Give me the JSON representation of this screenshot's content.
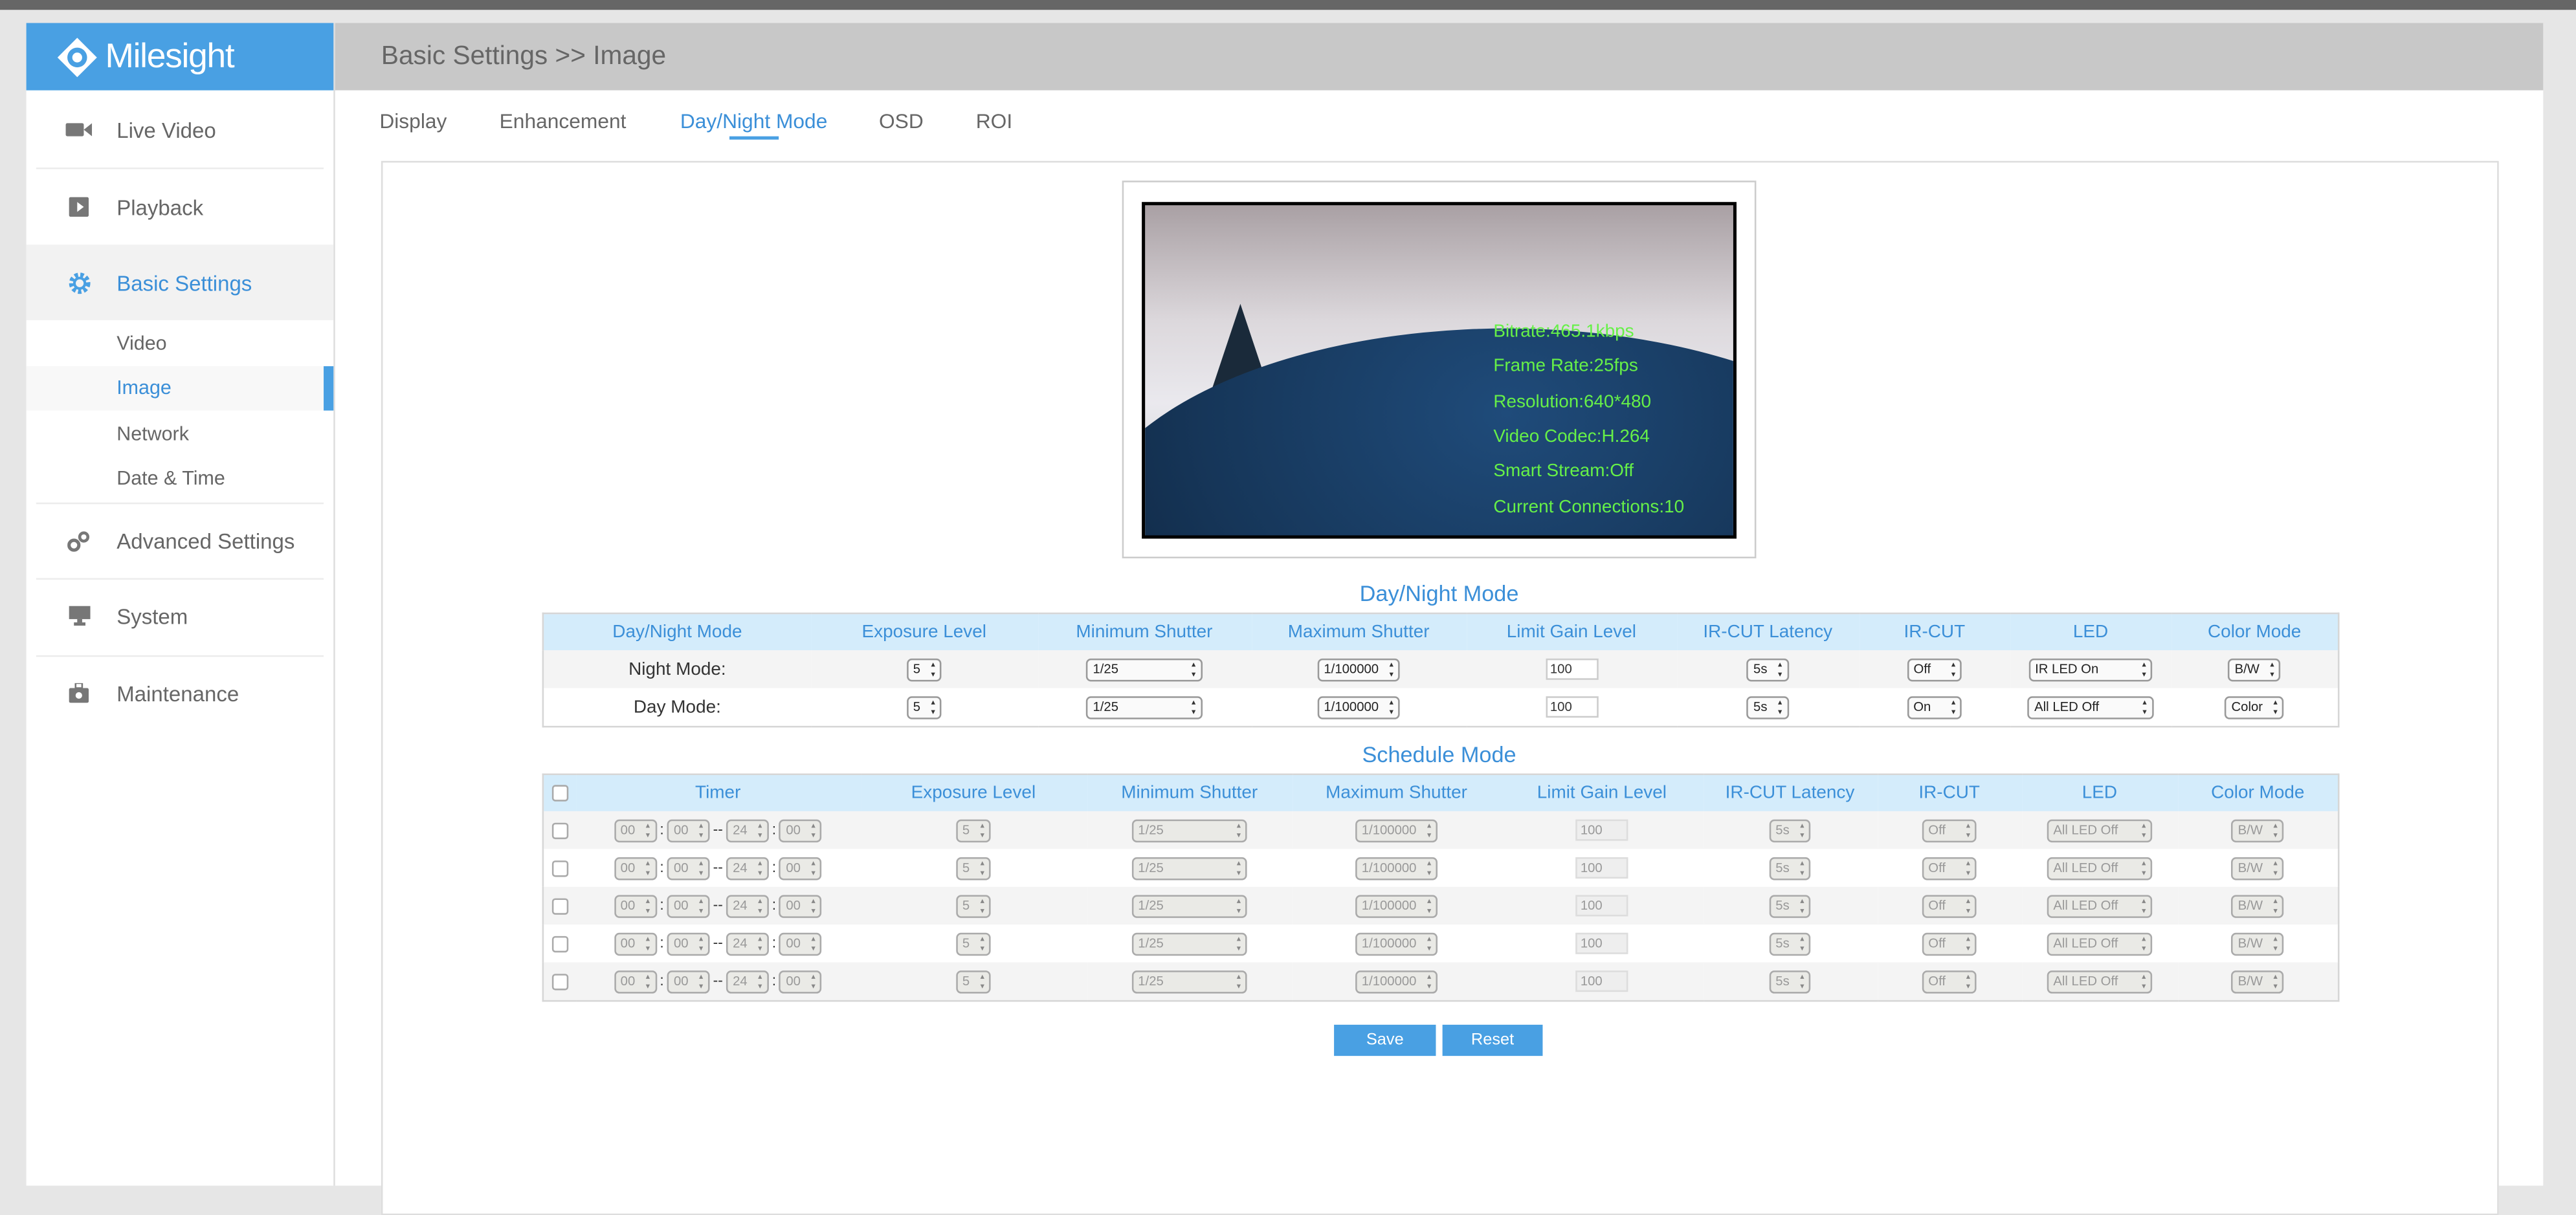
{
  "brand": {
    "name": "Milesight"
  },
  "header": {
    "breadcrumb": "Basic Settings >> Image"
  },
  "sidebar": {
    "items": [
      {
        "label": "Live Video",
        "icon": "video-camera-icon"
      },
      {
        "label": "Playback",
        "icon": "playback-icon"
      },
      {
        "label": "Basic Settings",
        "icon": "gear-icon",
        "active": true
      },
      {
        "label": "Advanced Settings",
        "icon": "gears-icon"
      },
      {
        "label": "System",
        "icon": "monitor-icon"
      },
      {
        "label": "Maintenance",
        "icon": "toolbox-icon"
      }
    ],
    "subitems": [
      {
        "label": "Video"
      },
      {
        "label": "Image",
        "active": true
      },
      {
        "label": "Network"
      },
      {
        "label": "Date & Time"
      }
    ]
  },
  "tabs": [
    {
      "label": "Display"
    },
    {
      "label": "Enhancement"
    },
    {
      "label": "Day/Night Mode",
      "active": true
    },
    {
      "label": "OSD"
    },
    {
      "label": "ROI"
    }
  ],
  "video": {
    "osd": [
      "Bitrate:465.1kbps",
      "Frame Rate:25fps",
      "Resolution:640*480",
      "Video Codec:H.264",
      "Smart Stream:Off",
      "Current Connections:10"
    ]
  },
  "day_night": {
    "title": "Day/Night Mode",
    "headers": [
      "Day/Night Mode",
      "Exposure Level",
      "Minimum Shutter",
      "Maximum Shutter",
      "Limit Gain Level",
      "IR-CUT Latency",
      "IR-CUT",
      "LED",
      "Color Mode"
    ],
    "rows": [
      {
        "label": "Night Mode:",
        "exposure": "5",
        "min_shutter": "1/25",
        "max_shutter": "1/100000",
        "gain": "100",
        "latency": "5s",
        "ircut": "Off",
        "led": "IR LED On",
        "color": "B/W"
      },
      {
        "label": "Day Mode:",
        "exposure": "5",
        "min_shutter": "1/25",
        "max_shutter": "1/100000",
        "gain": "100",
        "latency": "5s",
        "ircut": "On",
        "led": "All LED Off",
        "color": "Color"
      }
    ]
  },
  "schedule": {
    "title": "Schedule Mode",
    "headers": [
      "Timer",
      "Exposure Level",
      "Minimum Shutter",
      "Maximum Shutter",
      "Limit Gain Level",
      "IR-CUT Latency",
      "IR-CUT",
      "LED",
      "Color Mode"
    ],
    "rows": [
      {
        "start_h": "00",
        "start_m": "00",
        "end_h": "24",
        "end_m": "00",
        "exposure": "5",
        "min_shutter": "1/25",
        "max_shutter": "1/100000",
        "gain": "100",
        "latency": "5s",
        "ircut": "Off",
        "led": "All LED Off",
        "color": "B/W"
      },
      {
        "start_h": "00",
        "start_m": "00",
        "end_h": "24",
        "end_m": "00",
        "exposure": "5",
        "min_shutter": "1/25",
        "max_shutter": "1/100000",
        "gain": "100",
        "latency": "5s",
        "ircut": "Off",
        "led": "All LED Off",
        "color": "B/W"
      },
      {
        "start_h": "00",
        "start_m": "00",
        "end_h": "24",
        "end_m": "00",
        "exposure": "5",
        "min_shutter": "1/25",
        "max_shutter": "1/100000",
        "gain": "100",
        "latency": "5s",
        "ircut": "Off",
        "led": "All LED Off",
        "color": "B/W"
      },
      {
        "start_h": "00",
        "start_m": "00",
        "end_h": "24",
        "end_m": "00",
        "exposure": "5",
        "min_shutter": "1/25",
        "max_shutter": "1/100000",
        "gain": "100",
        "latency": "5s",
        "ircut": "Off",
        "led": "All LED Off",
        "color": "B/W"
      },
      {
        "start_h": "00",
        "start_m": "00",
        "end_h": "24",
        "end_m": "00",
        "exposure": "5",
        "min_shutter": "1/25",
        "max_shutter": "1/100000",
        "gain": "100",
        "latency": "5s",
        "ircut": "Off",
        "led": "All LED Off",
        "color": "B/W"
      }
    ]
  },
  "buttons": {
    "save": "Save",
    "reset": "Reset"
  },
  "colors": {
    "accent": "#49a0e3",
    "header_bg": "#c8c8c8",
    "table_header": "#d4ecfb",
    "osd_text": "#66f048"
  }
}
